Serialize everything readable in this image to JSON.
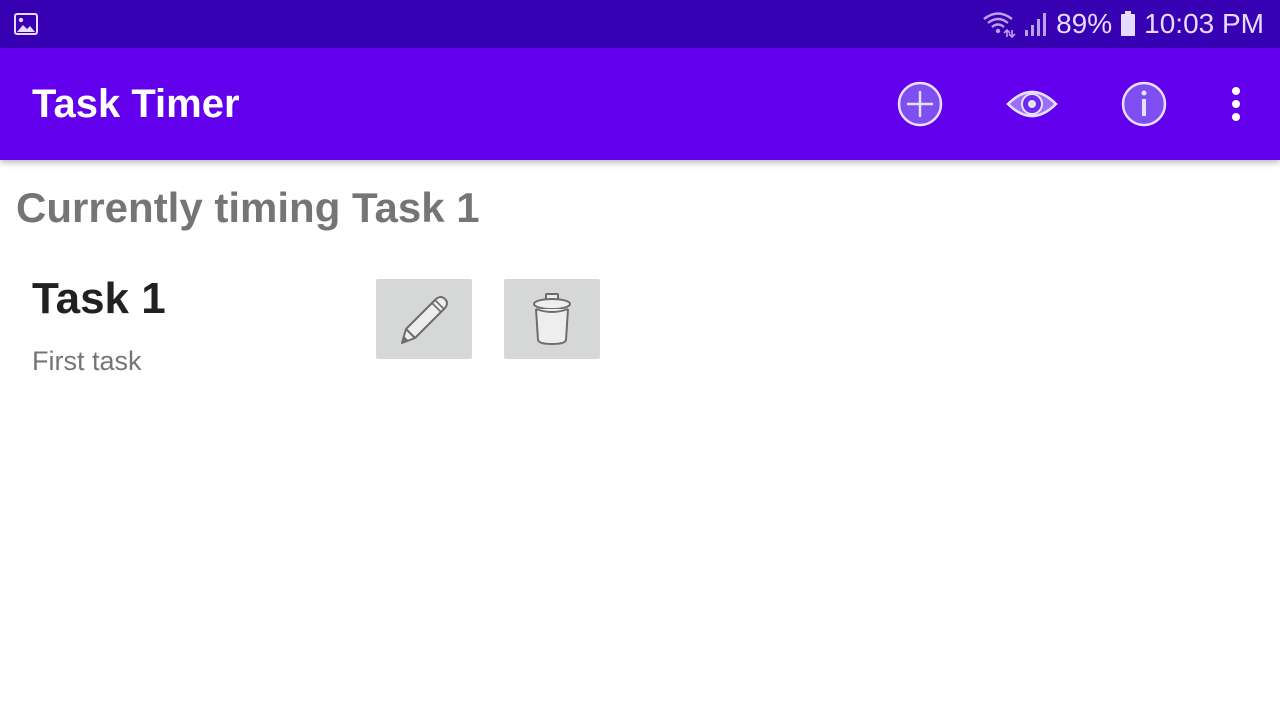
{
  "status_bar": {
    "left_icon": "image-icon",
    "icons": [
      "wifi-icon",
      "signal-icon",
      "battery-icon"
    ],
    "battery_percent": "89%",
    "time": "10:03 PM"
  },
  "app_bar": {
    "title": "Task Timer",
    "actions": [
      {
        "name": "add-task-button",
        "icon": "plus-circle-icon"
      },
      {
        "name": "view-durations-button",
        "icon": "eye-icon"
      },
      {
        "name": "about-button",
        "icon": "info-icon"
      },
      {
        "name": "overflow-menu-button",
        "icon": "more-vert-icon"
      }
    ]
  },
  "main": {
    "current_timing": "Currently timing Task 1",
    "tasks": [
      {
        "name": "Task 1",
        "description": "First task",
        "edit_icon": "pencil-icon",
        "delete_icon": "trash-icon"
      }
    ]
  },
  "colors": {
    "status_bar": "#3700b3",
    "app_bar": "#6200ee",
    "heading_gray": "#757575",
    "button_bg": "#d6d7d7"
  }
}
